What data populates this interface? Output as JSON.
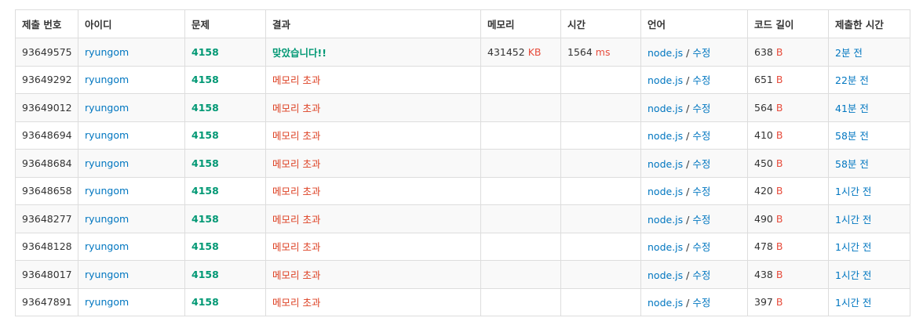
{
  "headers": {
    "id": "제출 번호",
    "user": "아이디",
    "problem": "문제",
    "result": "결과",
    "memory": "메모리",
    "time": "시간",
    "language": "언어",
    "code_length": "코드 길이",
    "submitted": "제출한 시간"
  },
  "units": {
    "memory": "KB",
    "time": "ms",
    "length": "B"
  },
  "language_link": "node.js",
  "language_sep": "/",
  "edit_label": "수정",
  "rows": [
    {
      "id": "93649575",
      "user": "ryungom",
      "problem": "4158",
      "result": "맞았습니다!!",
      "result_type": "ac",
      "memory": "431452",
      "time": "1564",
      "length": "638",
      "submitted": "2분 전"
    },
    {
      "id": "93649292",
      "user": "ryungom",
      "problem": "4158",
      "result": "메모리 초과",
      "result_type": "mle",
      "memory": "",
      "time": "",
      "length": "651",
      "submitted": "22분 전"
    },
    {
      "id": "93649012",
      "user": "ryungom",
      "problem": "4158",
      "result": "메모리 초과",
      "result_type": "mle",
      "memory": "",
      "time": "",
      "length": "564",
      "submitted": "41분 전"
    },
    {
      "id": "93648694",
      "user": "ryungom",
      "problem": "4158",
      "result": "메모리 초과",
      "result_type": "mle",
      "memory": "",
      "time": "",
      "length": "410",
      "submitted": "58분 전"
    },
    {
      "id": "93648684",
      "user": "ryungom",
      "problem": "4158",
      "result": "메모리 초과",
      "result_type": "mle",
      "memory": "",
      "time": "",
      "length": "450",
      "submitted": "58분 전"
    },
    {
      "id": "93648658",
      "user": "ryungom",
      "problem": "4158",
      "result": "메모리 초과",
      "result_type": "mle",
      "memory": "",
      "time": "",
      "length": "420",
      "submitted": "1시간 전"
    },
    {
      "id": "93648277",
      "user": "ryungom",
      "problem": "4158",
      "result": "메모리 초과",
      "result_type": "mle",
      "memory": "",
      "time": "",
      "length": "490",
      "submitted": "1시간 전"
    },
    {
      "id": "93648128",
      "user": "ryungom",
      "problem": "4158",
      "result": "메모리 초과",
      "result_type": "mle",
      "memory": "",
      "time": "",
      "length": "478",
      "submitted": "1시간 전"
    },
    {
      "id": "93648017",
      "user": "ryungom",
      "problem": "4158",
      "result": "메모리 초과",
      "result_type": "mle",
      "memory": "",
      "time": "",
      "length": "438",
      "submitted": "1시간 전"
    },
    {
      "id": "93647891",
      "user": "ryungom",
      "problem": "4158",
      "result": "메모리 초과",
      "result_type": "mle",
      "memory": "",
      "time": "",
      "length": "397",
      "submitted": "1시간 전"
    }
  ],
  "colors": {
    "accepted": "#009874",
    "memory_limit": "#dd4124",
    "link": "#0076c0",
    "unit": "#e74c3c",
    "border": "#dddddd",
    "stripe": "#f9f9f9"
  }
}
